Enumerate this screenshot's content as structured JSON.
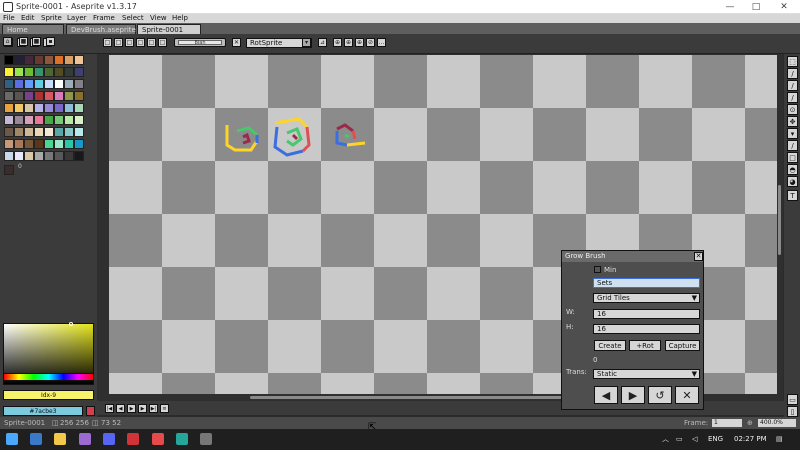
{
  "window": {
    "title": "Sprite-0001 - Aseprite v1.3.17",
    "minimize": "—",
    "maximize": "□",
    "close": "✕"
  },
  "menu": [
    "File",
    "Edit",
    "Sprite",
    "Layer",
    "Frame",
    "Select",
    "View",
    "Help"
  ],
  "tabs": [
    {
      "label": "Home"
    },
    {
      "label": "DevBrush.aseprite"
    },
    {
      "label": "Sprite-0001"
    }
  ],
  "context": {
    "brush_combo": "RotSprite",
    "swatch_text": "Blah"
  },
  "palette": {
    "colors": [
      "#000000",
      "#222034",
      "#45283c",
      "#663931",
      "#8f563b",
      "#df7126",
      "#d9a066",
      "#eec39a",
      "#fbf236",
      "#99e550",
      "#6abe30",
      "#37946e",
      "#4b692f",
      "#524b24",
      "#323c39",
      "#3f3f74",
      "#306082",
      "#5b6ee1",
      "#639bff",
      "#5fcde4",
      "#cbdbfc",
      "#ffffff",
      "#9badb7",
      "#847e87",
      "#696a6a",
      "#595652",
      "#76428a",
      "#ac3232",
      "#d95763",
      "#d77bba",
      "#8f974a",
      "#8a6f30",
      "#e8a43c",
      "#f0c868",
      "#d8c8a8",
      "#b8b0e8",
      "#9888d8",
      "#7868c8",
      "#8fbcd8",
      "#a8d8b8",
      "#c8b8d8",
      "#988898",
      "#d8a0b8",
      "#e87898",
      "#48a848",
      "#78c878",
      "#b8e8a8",
      "#d8f0c8",
      "#6e5848",
      "#9e8868",
      "#ceb898",
      "#e8d8b8",
      "#f0e8d8",
      "#58a8a8",
      "#88c8c8",
      "#b8e8e8",
      "#c89878",
      "#a87858",
      "#785838",
      "#583818",
      "#48d890",
      "#98e8c8",
      "#28c8a8",
      "#1898c8",
      "#c8d8e8",
      "#e8e8f8",
      "#d8c8a8",
      "#a8a8a8",
      "#787878",
      "#585858",
      "#383838",
      "#181818"
    ],
    "index_label": "0"
  },
  "colors": {
    "foreground_label": "Idx-9",
    "background_label": "#7acbe3",
    "foreground_hex": "#f8f26a",
    "background_hex": "#7bcadd"
  },
  "status": {
    "left": "Sprite-0001",
    "size": "256 256",
    "pos": "73 52",
    "frame_label": "Frame:",
    "frame_value": "1",
    "zoom": "400.0%"
  },
  "dialog": {
    "title": "Grow Brush",
    "min_label": "Min",
    "sets_label": "Sets",
    "mode_select": "Grid Tiles",
    "w_label": "W:",
    "w_value": "16",
    "h_label": "H:",
    "h_value": "16",
    "create": "Create",
    "rot": "+Rot",
    "capture": "Capture",
    "zero_label": "0",
    "trans_label": "Trans:",
    "trans_select": "Static",
    "prev": "◀",
    "next": "▶",
    "refresh": "↺",
    "close": "✕"
  },
  "taskbar": {
    "language": "ENG",
    "time": "02:27 PM"
  }
}
